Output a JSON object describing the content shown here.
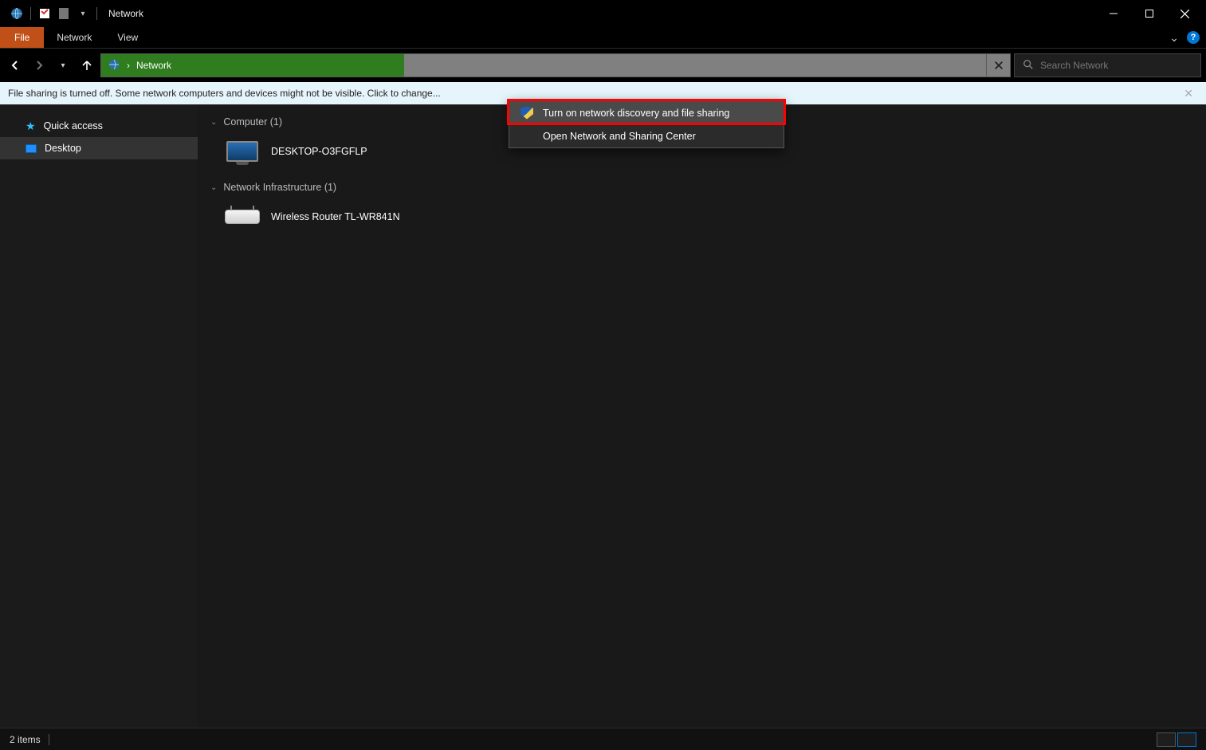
{
  "titlebar": {
    "title": "Network"
  },
  "ribbon": {
    "tabs": {
      "file": "File",
      "network": "Network",
      "view": "View"
    }
  },
  "nav": {
    "breadcrumb_root_icon": "network-icon",
    "breadcrumb_sep": "›",
    "breadcrumb_label": "Network"
  },
  "search": {
    "placeholder": "Search Network"
  },
  "infobar": {
    "message": "File sharing is turned off. Some network computers and devices might not be visible. Click to change..."
  },
  "context_menu": {
    "items": [
      "Turn on network discovery and file sharing",
      "Open Network and Sharing Center"
    ]
  },
  "sidebar": {
    "items": [
      {
        "icon": "star",
        "label": "Quick access"
      },
      {
        "icon": "desktop",
        "label": "Desktop"
      }
    ]
  },
  "content": {
    "groups": [
      {
        "header": "Computer (1)",
        "items": [
          {
            "icon": "monitor",
            "label": "DESKTOP-O3FGFLP"
          }
        ]
      },
      {
        "header": "Network Infrastructure (1)",
        "items": [
          {
            "icon": "router",
            "label": "Wireless Router TL-WR841N"
          }
        ]
      }
    ]
  },
  "statusbar": {
    "text": "2 items"
  }
}
